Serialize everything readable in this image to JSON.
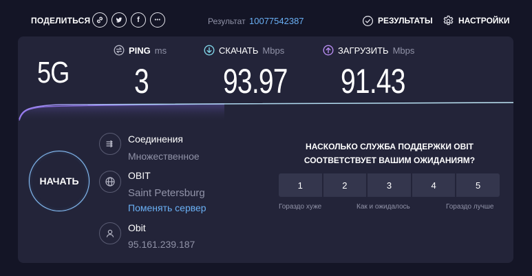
{
  "header": {
    "share_label": "ПОДЕЛИТЬСЯ",
    "share_buttons": [
      {
        "icon": "link-icon"
      },
      {
        "icon": "twitter-icon"
      },
      {
        "icon": "facebook-icon",
        "glyph": "f"
      },
      {
        "icon": "more-icon",
        "glyph": "•••"
      }
    ],
    "result_label": "Результат",
    "result_id": "10077542387",
    "results_label": "РЕЗУЛЬТАТЫ",
    "settings_label": "НАСТРОЙКИ"
  },
  "test": {
    "connection_type": "5G",
    "ping": {
      "label": "PING",
      "unit": "ms",
      "value": "3"
    },
    "download": {
      "label": "СКАЧАТЬ",
      "unit": "Mbps",
      "value": "93.97"
    },
    "upload": {
      "label": "ЗАГРУЗИТЬ",
      "unit": "Mbps",
      "value": "91.43"
    }
  },
  "start_button": "НАЧАТЬ",
  "connections": {
    "title": "Соединения",
    "value": "Множественное"
  },
  "server": {
    "name": "OBIT",
    "location": "Saint Petersburg",
    "change_link": "Поменять сервер"
  },
  "provider": {
    "name": "Obit",
    "ip": "95.161.239.187"
  },
  "survey": {
    "question_line1": "НАСКОЛЬКО СЛУЖБА ПОДДЕРЖКИ OBIT",
    "question_line2": "СООТВЕТСТВУЕТ ВАШИМ ОЖИДАНИЯМ?",
    "options": [
      "1",
      "2",
      "3",
      "4",
      "5"
    ],
    "low_label": "Гораздо хуже",
    "mid_label": "Как и ожидалось",
    "high_label": "Гораздо лучше"
  },
  "colors": {
    "background": "#141526",
    "panel": "#232439",
    "accent_blue": "#6ab0f5",
    "download_icon": "#7fd3e6",
    "upload_icon": "#b78cf0",
    "muted_text": "#9193a8"
  }
}
